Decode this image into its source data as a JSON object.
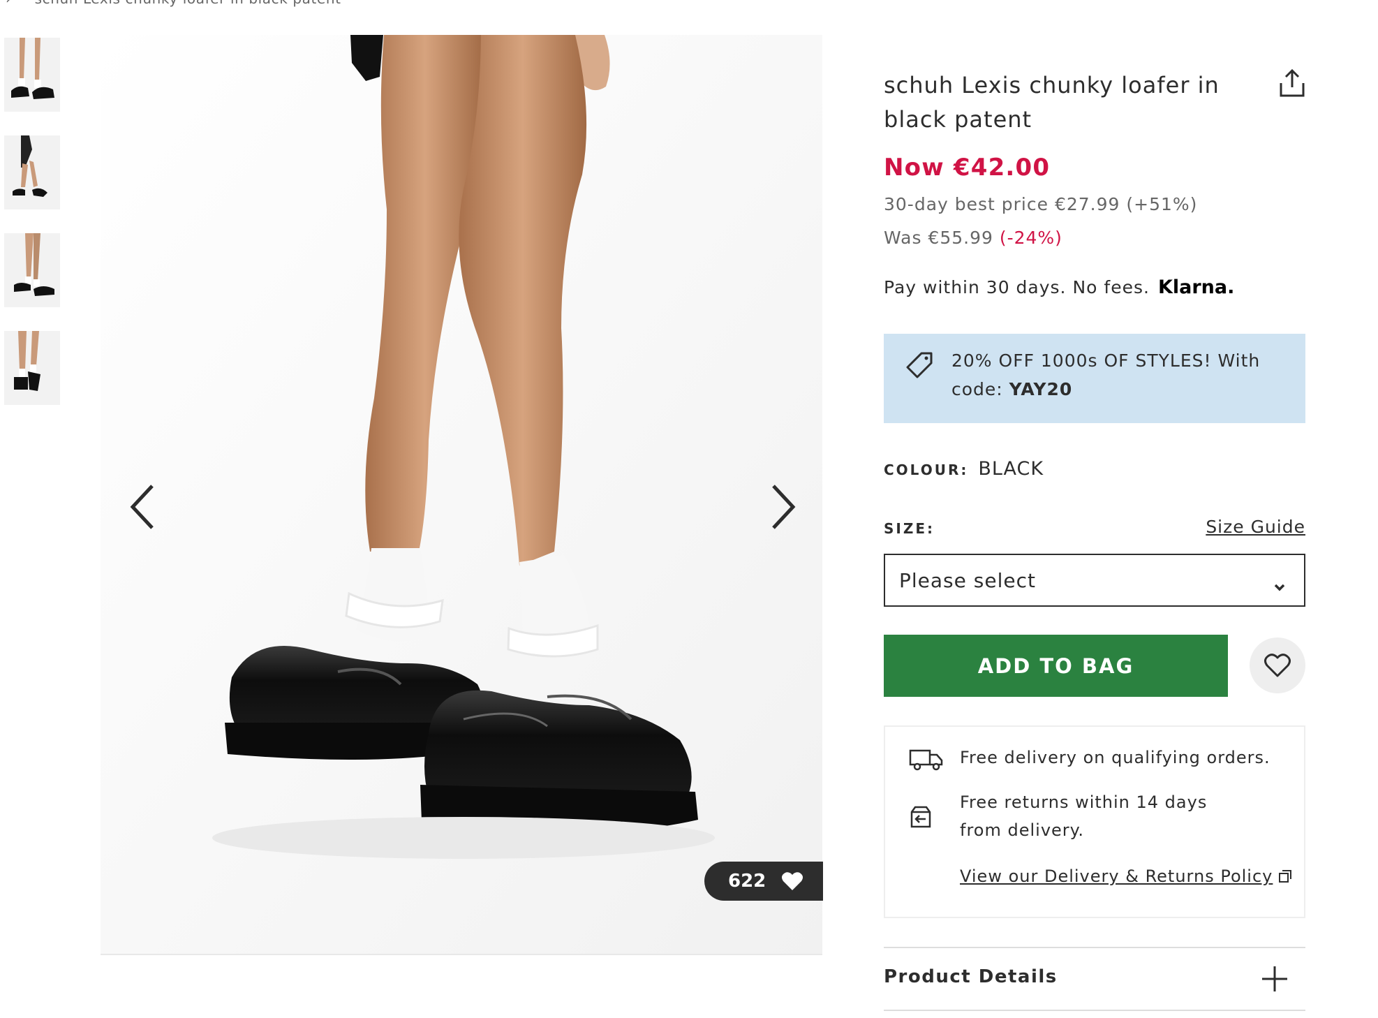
{
  "breadcrumb": {
    "separator": "›",
    "current": "schuh Lexis chunky loafer in black patent"
  },
  "gallery": {
    "thumbnails": [
      "thumbnail-1",
      "thumbnail-2",
      "thumbnail-3",
      "thumbnail-4"
    ],
    "prev_icon": "chevron-left-icon",
    "next_icon": "chevron-right-icon",
    "save_count": "622"
  },
  "product": {
    "title": "schuh Lexis chunky loafer in black patent",
    "now_price": "Now €42.00",
    "best_price": "30-day best price €27.99 (+51%)",
    "was_price": "Was €55.99",
    "was_discount": "(-24%)",
    "klarna_text": "Pay within 30 days. No fees.",
    "klarna_logo": "Klarna."
  },
  "promo": {
    "text": "20% OFF 1000s OF STYLES! With code: ",
    "code": "YAY20"
  },
  "colour": {
    "label": "COLOUR:",
    "value": "BLACK"
  },
  "size": {
    "label": "SIZE:",
    "guide_link": "Size Guide",
    "placeholder": "Please select"
  },
  "actions": {
    "add_to_bag": "ADD TO BAG"
  },
  "delivery": {
    "free_delivery": "Free delivery on qualifying orders.",
    "free_returns": "Free returns within 14 days from delivery.",
    "policy_link": "View our Delivery & Returns Policy"
  },
  "accordion": {
    "product_details": "Product Details"
  },
  "colors": {
    "sale_red": "#d01345",
    "add_bag_green": "#2b8240",
    "promo_blue": "#cfe3f2",
    "text_dark": "#2d2d2d"
  }
}
